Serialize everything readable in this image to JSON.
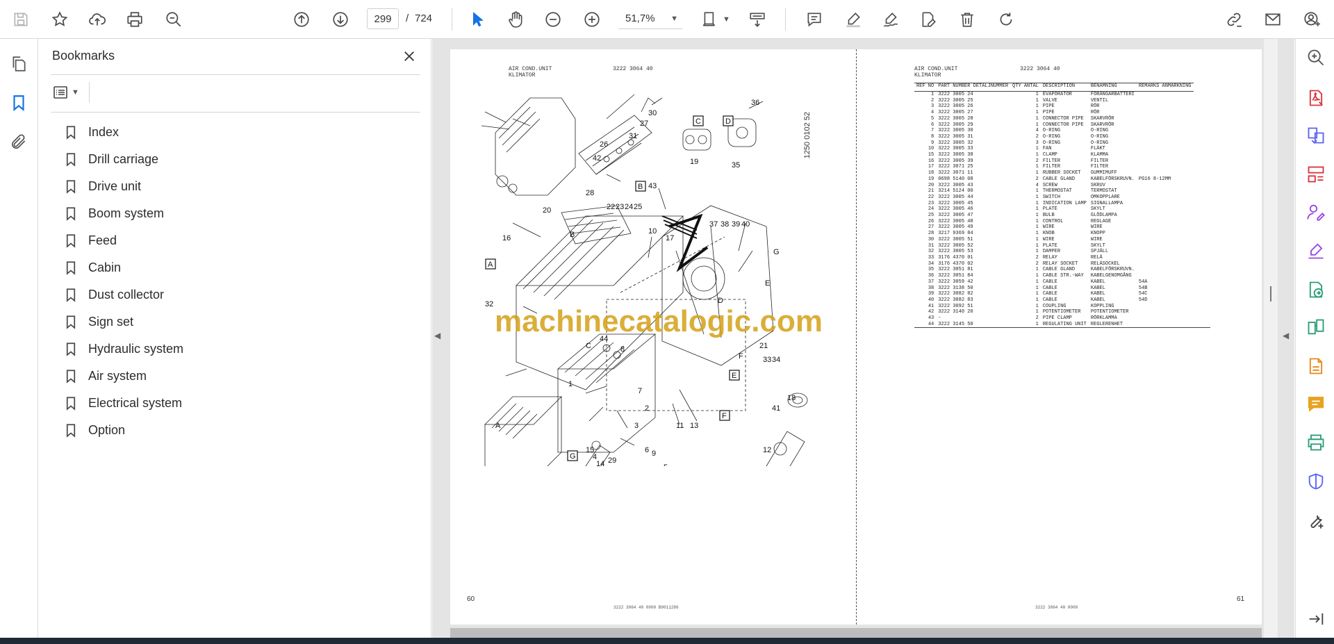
{
  "toolbar": {
    "page_current": "299",
    "page_separator": "/",
    "page_total": "724",
    "zoom": "51,7%"
  },
  "bookmarks": {
    "title": "Bookmarks",
    "items": [
      {
        "label": "Index"
      },
      {
        "label": "Drill carriage"
      },
      {
        "label": "Drive unit"
      },
      {
        "label": "Boom system"
      },
      {
        "label": "Feed"
      },
      {
        "label": "Cabin"
      },
      {
        "label": "Dust collector"
      },
      {
        "label": "Sign set"
      },
      {
        "label": "Hydraulic system"
      },
      {
        "label": "Air system"
      },
      {
        "label": "Electrical system"
      },
      {
        "label": "Option"
      }
    ]
  },
  "left_page": {
    "header_title": "AIR COND.UNIT",
    "header_subtitle": "KLIMATOR",
    "header_code": "3222 3064 40",
    "drawing_code": "1250 0102 52",
    "page_number": "60",
    "footer": "3222 3064 40  0000  B0011286"
  },
  "right_page": {
    "header_title": "AIR COND.UNIT",
    "header_subtitle": "KLIMATOR",
    "header_code": "3222 3064 40",
    "page_number": "61",
    "footer": "3222 3064 40  0000",
    "columns": [
      "REF NO",
      "PART NUMBER DETALJNUMMER",
      "QTY ANTAL",
      "DESCRIPTION",
      "BENÄMNING",
      "REMARKS ANMÄRKNING"
    ],
    "rows": [
      [
        "1",
        "3222 3005 24",
        "1",
        "EVAPORATOR",
        "FÖRÅNGARBATTERI",
        ""
      ],
      [
        "2",
        "3222 3005 25",
        "1",
        "VALVE",
        "VENTIL",
        ""
      ],
      [
        "3",
        "3222 3005 26",
        "1",
        "PIPE",
        "RÖR",
        ""
      ],
      [
        "4",
        "3222 3005 27",
        "1",
        "PIPE",
        "RÖR",
        ""
      ],
      [
        "5",
        "3222 3005 28",
        "1",
        "CONNECTOR PIPE",
        "SKARVRÖR",
        ""
      ],
      [
        "6",
        "3222 3005 29",
        "1",
        "CONNECTOR PIPE",
        "SKARVRÖR",
        ""
      ],
      [
        "7",
        "3222 3005 30",
        "4",
        "O-RING",
        "O-RING",
        ""
      ],
      [
        "8",
        "3222 3005 31",
        "2",
        "O-RING",
        "O-RING",
        ""
      ],
      [
        "9",
        "3222 3005 32",
        "3",
        "O-RING",
        "O-RING",
        ""
      ],
      [
        "10",
        "3222 3005 33",
        "1",
        "FAN",
        "FLÄKT",
        ""
      ],
      [
        "15",
        "3222 3005 38",
        "1",
        "CLAMP",
        "KLAMMA",
        ""
      ],
      [
        "16",
        "3222 3005 39",
        "2",
        "FILTER",
        "FILTER",
        ""
      ],
      [
        "17",
        "3222 3071 25",
        "1",
        "FILTER",
        "FILTER",
        ""
      ],
      [
        "18",
        "3222 3071 11",
        "1",
        "RUBBER SOCKET",
        "GUMMIMUFF",
        ""
      ],
      [
        "19",
        "0698 5140 08",
        "2",
        "CABLE GLAND",
        "KABELFÖRSKRUVN.",
        "PG16  8-12MM"
      ],
      [
        "20",
        "3222 3005 43",
        "4",
        "SCREW",
        "SKRUV",
        ""
      ],
      [
        "21",
        "3214 5124 00",
        "1",
        "THERMOSTAT",
        "TERMOSTAT",
        ""
      ],
      [
        "22",
        "3222 3005 44",
        "1",
        "SWITCH",
        "OMKOPPLARE",
        ""
      ],
      [
        "23",
        "3222 3005 45",
        "1",
        "INDICATION LAMP",
        "SIGNALLAMPA",
        ""
      ],
      [
        "24",
        "3222 3005 46",
        "1",
        "PLATE",
        "SKYLT",
        ""
      ],
      [
        "25",
        "3222 3005 47",
        "1",
        "BULB",
        "GLÖDLAMPA",
        ""
      ],
      [
        "26",
        "3222 3005 48",
        "1",
        "CONTROL",
        "REGLAGE",
        ""
      ],
      [
        "27",
        "3222 3005 49",
        "1",
        "WIRE",
        "WIRE",
        ""
      ],
      [
        "28",
        "3217 9369 84",
        "1",
        "KNOB",
        "KNOPP",
        ""
      ],
      [
        "30",
        "3222 3005 51",
        "1",
        "WIRE",
        "WIRE",
        ""
      ],
      [
        "31",
        "3222 3005 52",
        "1",
        "PLATE",
        "SKYLT",
        ""
      ],
      [
        "32",
        "3222 3005 53",
        "1",
        "DAMPER",
        "SPJÄLL",
        ""
      ],
      [
        "33",
        "3176 4370 01",
        "2",
        "RELAY",
        "RELÄ",
        ""
      ],
      [
        "34",
        "3176 4370 02",
        "2",
        "RELAY SOCKET",
        "RELÄSOCKEL",
        ""
      ],
      [
        "35",
        "3222 3051 81",
        "1",
        "CABLE GLAND",
        "KABELFÖRSKRUVN.",
        ""
      ],
      [
        "36",
        "3222 3051 84",
        "1",
        "CABLE STR.-WAY",
        "KABELGENOMGÅNG",
        ""
      ],
      [
        "37",
        "3222 3059 42",
        "1",
        "CABLE",
        "KABEL",
        "54A"
      ],
      [
        "38",
        "3222 3138 50",
        "1",
        "CABLE",
        "KABEL",
        "54B"
      ],
      [
        "39",
        "3222 3082 82",
        "1",
        "CABLE",
        "KABEL",
        "54C"
      ],
      [
        "40",
        "3222 3082 83",
        "1",
        "CABLE",
        "KABEL",
        "54D"
      ],
      [
        "41",
        "3222 3092 51",
        "1",
        "COUPLING",
        "KOPPLING",
        ""
      ],
      [
        "42",
        "3222 3140 20",
        "1",
        "POTENTIOMETER",
        "POTENTIOMETER",
        ""
      ],
      [
        "43",
        "-",
        "2",
        "PIPE CLAMP",
        "RÖRKLAMMA",
        ""
      ],
      [
        "44",
        "3222 3145 50",
        "1",
        "REGULATING UNIT",
        "REGLERENHET",
        ""
      ]
    ]
  },
  "watermark": "machinecatalogic.com",
  "colors": {
    "accent": "#1473e6",
    "watermark": "#d4a017",
    "tool_red": "#d7373f",
    "tool_purple": "#9a47e2",
    "tool_orange": "#e68619",
    "tool_green": "#2d9d78",
    "tool_yellow": "#e6a31e"
  }
}
